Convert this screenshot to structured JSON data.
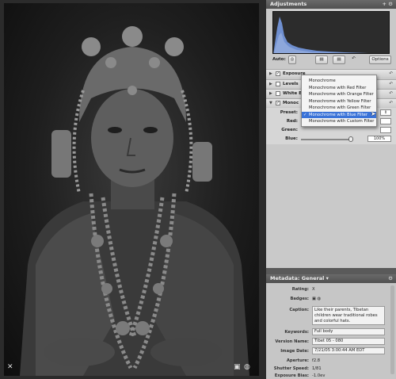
{
  "adjustments": {
    "title": "Adjustments",
    "header_icons": [
      "add-icon",
      "gear-icon"
    ],
    "auto_label": "Auto:",
    "options_label": "Options",
    "bricks": [
      {
        "name": "Exposure",
        "checked": true,
        "expanded": false
      },
      {
        "name": "Levels",
        "checked": false,
        "expanded": false
      },
      {
        "name": "White B",
        "checked": false,
        "expanded": false
      },
      {
        "name": "Monoc",
        "checked": true,
        "expanded": true
      }
    ],
    "mono": {
      "preset_label": "Preset:",
      "red_label": "Red:",
      "green_label": "Green:",
      "blue_label": "Blue:",
      "blue_value": "100%"
    },
    "preset_menu": {
      "items": [
        "Monochrome",
        "Monochrome with Red Filter",
        "Monochrome with Orange Filter",
        "Monochrome with Yellow Filter",
        "Monochrome with Green Filter",
        "Monochrome with Blue Filter",
        "Monochrome with Custom Filter"
      ],
      "selected_index": 5
    }
  },
  "metadata": {
    "title": "Metadata: General",
    "rows": [
      {
        "label": "Rating:",
        "value": "X",
        "kind": "text"
      },
      {
        "label": "Badges:",
        "value": "",
        "kind": "icons"
      },
      {
        "label": "Caption:",
        "value": "Like their parents, Tibetan children wear traditional robes and colorful hats.",
        "kind": "caption"
      },
      {
        "label": "Keywords:",
        "value": "Full body",
        "kind": "field"
      },
      {
        "label": "Version Name:",
        "value": "Tibet 05 - 080",
        "kind": "field"
      },
      {
        "label": "Image Date:",
        "value": "7/21/05 3:00:44 AM EDT",
        "kind": "field"
      },
      {
        "label": "Aperture:",
        "value": "f2.8",
        "kind": "text"
      },
      {
        "label": "Shutter Speed:",
        "value": "1/81",
        "kind": "text"
      },
      {
        "label": "Exposure Bias:",
        "value": "-1.0ev",
        "kind": "text"
      }
    ]
  },
  "viewer": {
    "corner_left_icon": "close-icon",
    "corner_right_icons": [
      "thumbnail-icon",
      "versions-icon"
    ]
  },
  "colors": {
    "selection": "#3b73d8",
    "histogram": "#6f8fd0"
  }
}
